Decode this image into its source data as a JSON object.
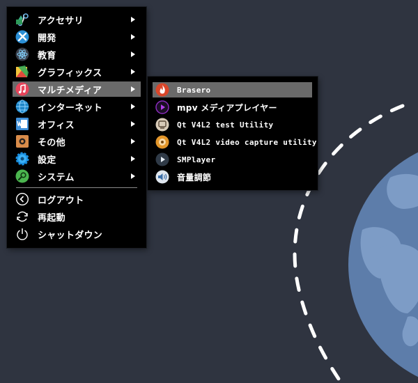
{
  "main_menu": {
    "items": [
      {
        "label": "アクセサリ",
        "icon": "accessories-icon",
        "has_submenu": true
      },
      {
        "label": "開発",
        "icon": "development-icon",
        "has_submenu": true
      },
      {
        "label": "教育",
        "icon": "education-icon",
        "has_submenu": true
      },
      {
        "label": "グラフィックス",
        "icon": "graphics-icon",
        "has_submenu": true
      },
      {
        "label": "マルチメディア",
        "icon": "multimedia-icon",
        "has_submenu": true,
        "active": true
      },
      {
        "label": "インターネット",
        "icon": "internet-icon",
        "has_submenu": true
      },
      {
        "label": "オフィス",
        "icon": "office-icon",
        "has_submenu": true
      },
      {
        "label": "その他",
        "icon": "other-icon",
        "has_submenu": true
      },
      {
        "label": "設定",
        "icon": "settings-icon",
        "has_submenu": true
      },
      {
        "label": "システム",
        "icon": "system-icon",
        "has_submenu": true
      }
    ],
    "session_items": [
      {
        "label": "ログアウト",
        "icon": "logout-icon"
      },
      {
        "label": "再起動",
        "icon": "restart-icon"
      },
      {
        "label": "シャットダウン",
        "icon": "shutdown-icon"
      }
    ]
  },
  "submenu": {
    "items": [
      {
        "label": "Brasero",
        "icon": "brasero-icon",
        "active": true
      },
      {
        "label": "mpv メディアプレイヤー",
        "icon": "mpv-icon"
      },
      {
        "label": "Qt V4L2 test Utility",
        "icon": "qt-v4l2-test-icon"
      },
      {
        "label": "Qt V4L2 video capture utility",
        "icon": "qt-v4l2-capture-icon"
      },
      {
        "label": "SMPlayer",
        "icon": "smplayer-icon"
      },
      {
        "label": "音量調節",
        "icon": "volume-control-icon"
      }
    ]
  },
  "colors": {
    "desktop_bg": "#2f3440",
    "menu_bg": "#000000",
    "highlight": "#6a6a6a",
    "planet": "#5f80ad",
    "orbit": "#ffffff"
  }
}
